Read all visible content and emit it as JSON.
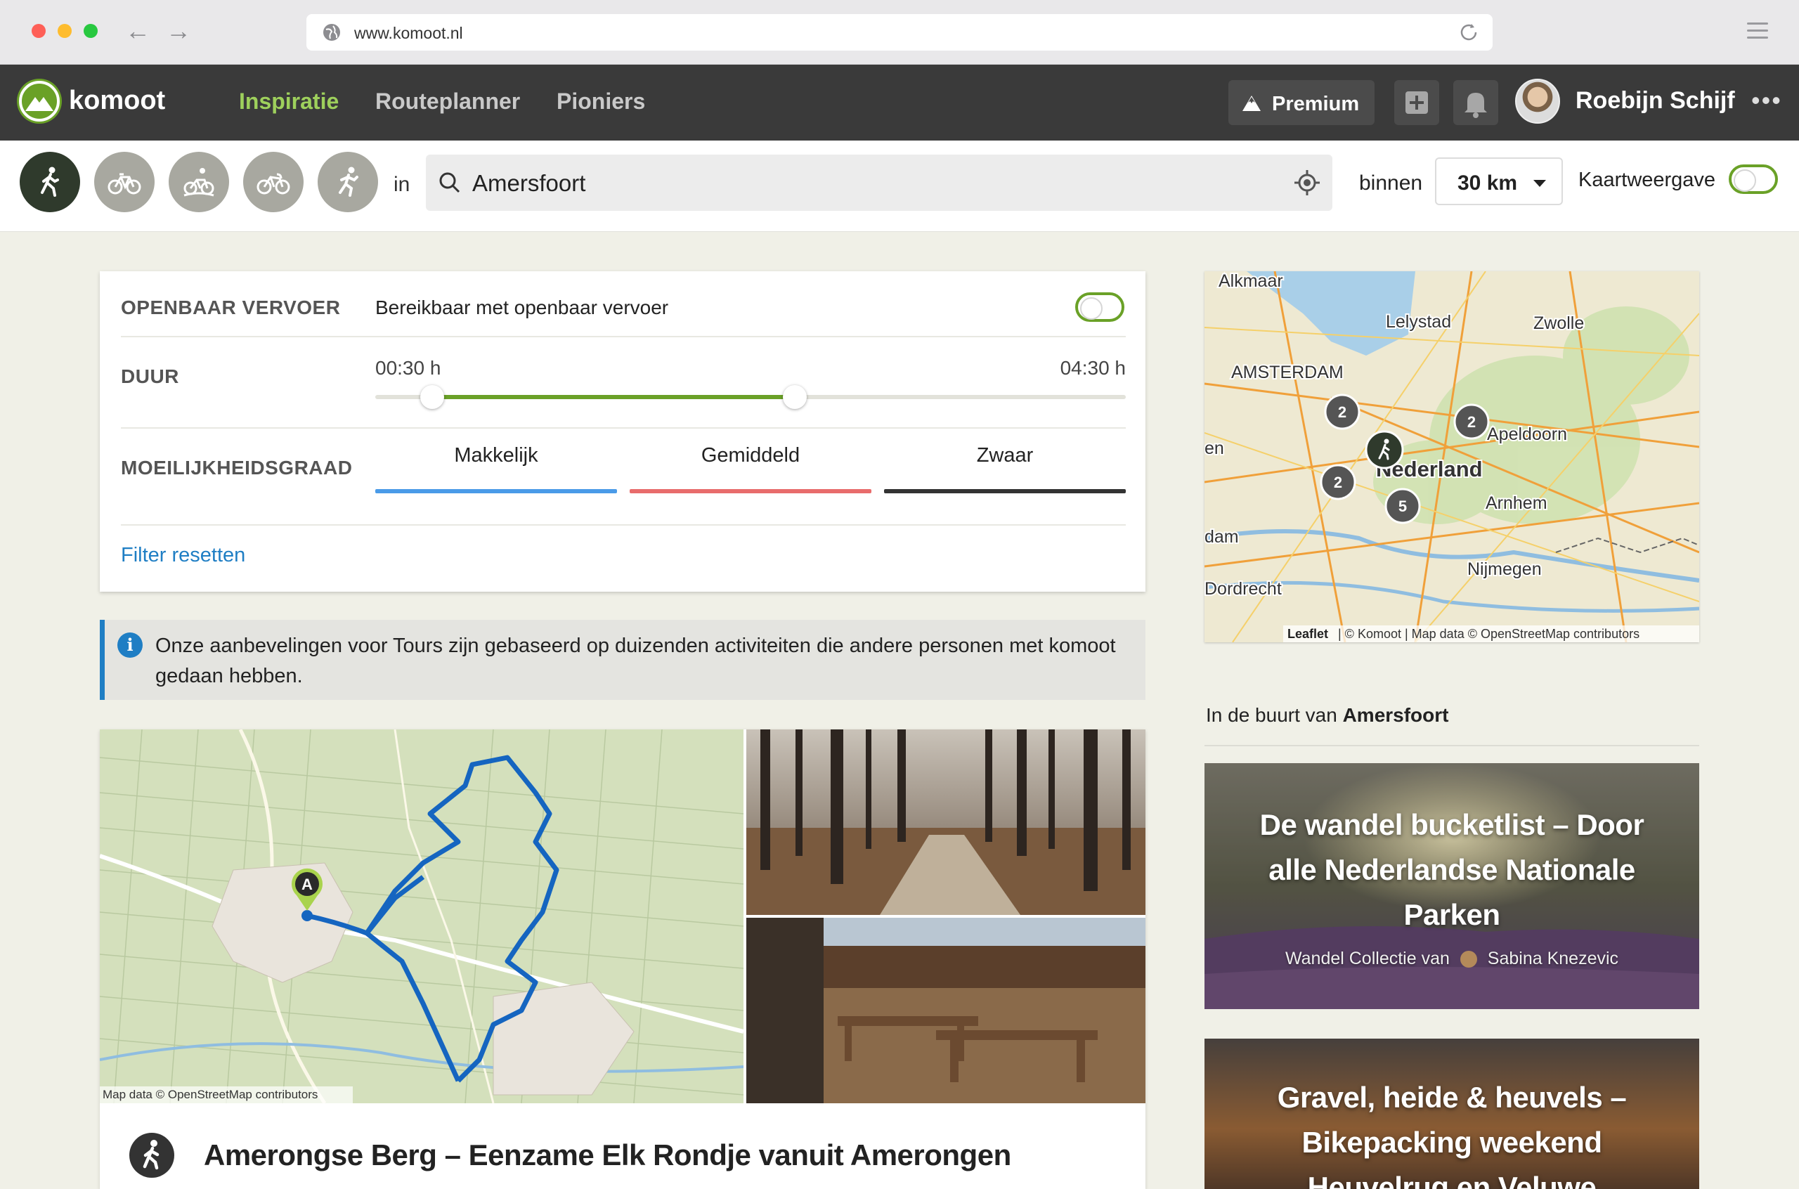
{
  "browser": {
    "url": "www.komoot.nl"
  },
  "header": {
    "logo_text": "komoot",
    "nav": [
      {
        "label": "Inspiratie",
        "active": true
      },
      {
        "label": "Routeplanner",
        "active": false
      },
      {
        "label": "Pioniers",
        "active": false
      }
    ],
    "premium_label": "Premium",
    "user_name": "Roebijn Schijf",
    "more": "•••"
  },
  "filters": {
    "sports": [
      "hiking",
      "touring-bike",
      "mountain-bike",
      "road-bike",
      "running"
    ],
    "in_label": "in",
    "search_value": "Amersfoort",
    "within_label": "binnen",
    "radius": "30 km",
    "map_view_label": "Kaartweergave"
  },
  "filter_card": {
    "transport_label": "OPENBAAR VERVOER",
    "transport_text": "Bereikbaar met openbaar vervoer",
    "duration_label": "DUUR",
    "duration_min": "00:30 h",
    "duration_max": "04:30 h",
    "duration_range_fraction": [
      0.075,
      0.56
    ],
    "difficulty_label": "MOEILIJKHEIDSGRAAD",
    "difficulties": [
      {
        "label": "Makkelijk",
        "color": "#4a9be8"
      },
      {
        "label": "Gemiddeld",
        "color": "#e86c6c"
      },
      {
        "label": "Zwaar",
        "color": "#333333"
      }
    ],
    "reset_label": "Filter resetten"
  },
  "info": {
    "text": "Onze aanbevelingen voor Tours zijn gebaseerd op duizenden activiteiten die andere personen met komoot gedaan hebben."
  },
  "tour": {
    "map_credit": "Map data © OpenStreetMap contributors",
    "start_marker": "A",
    "title": "Amerongse Berg – Eenzame Elk Rondje vanuit Amerongen"
  },
  "side_map": {
    "cities": [
      "Alkmaar",
      "Lelystad",
      "Zwolle",
      "AMSTERDAM",
      "Apeldoorn",
      "Nederland",
      "Arnhem",
      "Nijmegen",
      "Dordrecht",
      "en",
      "dam"
    ],
    "clusters": [
      "2",
      "2",
      "2",
      "5"
    ],
    "credit_leaflet": "Leaflet",
    "credit_rest": "| © Komoot | Map data © OpenStreetMap contributors"
  },
  "nearby": {
    "prefix": "In de buurt van ",
    "place": "Amersfoort",
    "collections": [
      {
        "title": "De wandel bucketlist – Door alle Nederlandse Nationale Parken",
        "sub_prefix": "Wandel Collectie van",
        "author": "Sabina Knezevic"
      },
      {
        "title": "Gravel, heide & heuvels – Bikepacking weekend Heuvelrug en Veluwe"
      }
    ]
  },
  "colors": {
    "accent_green": "#6aa127",
    "nav_active": "#9ed05c",
    "link_blue": "#1f7ec4"
  }
}
